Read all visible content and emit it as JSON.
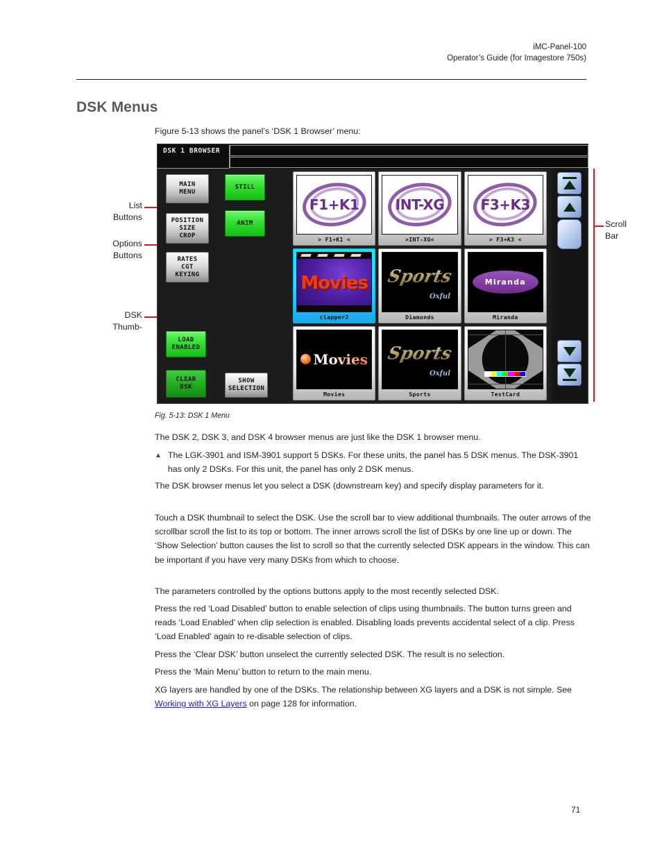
{
  "header": {
    "line1": "iMC-Panel-100",
    "line2": "Operator’s Guide (for Imagestore 750s)"
  },
  "section_title": "DSK Menus",
  "intro": "Figure 5-13 shows the panel’s ‘DSK 1 Browser’ menu:",
  "annotations": {
    "list_buttons": "List\nButtons",
    "options_buttons": "Options\nButtons",
    "dsk_thumbnails": "DSK\nThumb-",
    "scroll_bar": "Scroll\nBar"
  },
  "panel": {
    "title": "DSK 1 BROWSER",
    "buttons": [
      {
        "id": "main-menu",
        "label": "MAIN\nMENU",
        "style": "grey"
      },
      {
        "id": "position-size-crop",
        "label": "POSITION\nSIZE\nCROP",
        "style": "grey"
      },
      {
        "id": "rates-cgt-keying",
        "label": "RATES\nCGT\nKEYING",
        "style": "grey"
      },
      {
        "id": "still",
        "label": "STILL",
        "style": "green"
      },
      {
        "id": "anim",
        "label": "ANIM",
        "style": "green"
      },
      {
        "id": "load-enabled",
        "label": "LOAD\nENABLED",
        "style": "green"
      },
      {
        "id": "clear-dsk",
        "label": "CLEAR\nDSK",
        "style": "greenmid"
      },
      {
        "id": "show-selection",
        "label": "SHOW\nSELECTION",
        "style": "grey"
      }
    ],
    "thumbnails": [
      {
        "id": "f1k1",
        "caption": "> F1+K1 <",
        "art": "ellipse",
        "art_text": "F1+K1",
        "selected": false
      },
      {
        "id": "intxg",
        "caption": ">INT-XG<",
        "art": "ellipse",
        "art_text": "INT-XG",
        "selected": false
      },
      {
        "id": "f3k3",
        "caption": "> F3+K3 <",
        "art": "ellipse",
        "art_text": "F3+K3",
        "selected": false
      },
      {
        "id": "clapper2",
        "caption": "clapper2",
        "art": "clapper",
        "art_text": "Movies",
        "selected": true
      },
      {
        "id": "diamonds",
        "caption": "Diamonds",
        "art": "sports",
        "art_text": "Sports",
        "art_text2": "Oxful",
        "selected": false
      },
      {
        "id": "miranda",
        "caption": "Miranda",
        "art": "miranda",
        "art_text": "Miranda",
        "selected": false
      },
      {
        "id": "movies",
        "caption": "Movies",
        "art": "movies",
        "art_text": "Movies",
        "selected": false
      },
      {
        "id": "sports",
        "caption": "Sports",
        "art": "sports",
        "art_text": "Sports",
        "art_text2": "Oxful",
        "selected": false
      },
      {
        "id": "testcard",
        "caption": "TestCard",
        "art": "testcard",
        "art_text": "",
        "selected": false
      }
    ],
    "scrollbar": {
      "top_button": "scroll-to-top",
      "up_button": "scroll-up-one",
      "thumb": "scroll-thumb",
      "down_button": "scroll-down-one",
      "bottom_button": "scroll-to-bottom"
    },
    "colors": {
      "panel_bg": "#1c1c1c",
      "green_button": "#35e035",
      "selected_thumb": "#37d9ff",
      "accent_purple": "#6a2d8c",
      "annotation_red": "#e1151a"
    }
  },
  "figure_caption": "Fig. 5-13: DSK 1 Menu",
  "paragraphs": {
    "p1": "The DSK 2, DSK 3, and DSK 4 browser menus are just like the DSK 1 browser menu.",
    "note": "The LGK-3901 and ISM-3901 support 5 DSKs. For these units, the panel has 5 DSK menus. The DSK-3901 has only 2 DSKs. For this unit, the panel has only 2 DSK menus.",
    "p2": "The DSK browser menus let you select a DSK (downstream key) and specify display parameters for it.",
    "p3": "Touch a DSK thumbnail to select the DSK. Use the scroll bar to view additional thumbnails. The outer arrows of the scrollbar scroll the list to its top or bottom. The inner arrows scroll the list of DSKs by one line up or down. The ‘Show Selection’ button causes the list to scroll so that the currently selected DSK appears in the window. This can be important if you have very many DSKs from which to choose.",
    "p4": "The parameters controlled by the options buttons apply to the most recently selected DSK.",
    "p5": "Press the red ‘Load Disabled’ button to enable selection of clips using thumbnails. The button turns green and reads ‘Load Enabled’ when clip selection is enabled. Disabling loads prevents accidental select of a clip. Press ‘Load Enabled’ again to re-disable selection of clips.",
    "p6": "Press the ‘Clear DSK’ button unselect the currently selected DSK. The result is no selection.",
    "p7": "Press the ‘Main Menu’ button to return to the main menu.",
    "p8_before": "XG layers are handled by one of the DSKs. The relationship between XG layers and a DSK is not simple. See ",
    "p8_link": "Working with XG Layers",
    "p8_after": " on page 128 for information."
  },
  "page_number": "71"
}
